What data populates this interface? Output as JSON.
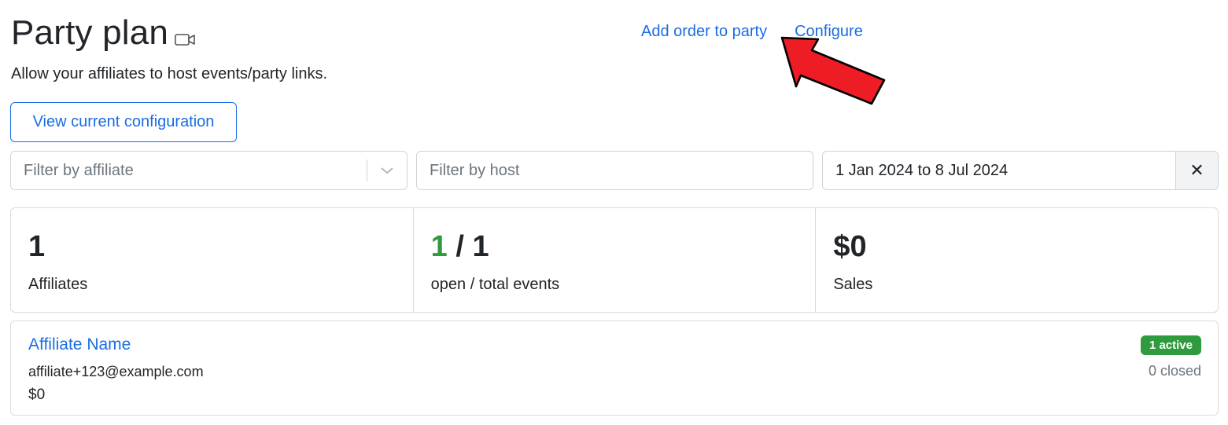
{
  "header": {
    "title": "Party plan",
    "title_icon": "video-camera-icon",
    "subtitle": "Allow your affiliates to host events/party links.",
    "links": {
      "add_order": "Add order to party",
      "configure": "Configure"
    }
  },
  "annotation": {
    "icon": "red-arrow-pointer",
    "color": "#ee1c25"
  },
  "buttons": {
    "view_config": "View current configuration"
  },
  "filters": {
    "affiliate_placeholder": "Filter by affiliate",
    "host_placeholder": "Filter by host",
    "date_range": "1 Jan 2024 to 8 Jul 2024",
    "clear_symbol": "✕"
  },
  "stats": {
    "affiliates": {
      "value": "1",
      "label": "Affiliates"
    },
    "events": {
      "open": "1",
      "separator": " / ",
      "total": "1",
      "label": "open / total events"
    },
    "sales": {
      "value": "$0",
      "label": "Sales"
    }
  },
  "affiliates": [
    {
      "name": "Affiliate Name",
      "email": "affiliate+123@example.com",
      "sales": "$0",
      "active_badge": "1 active",
      "closed": "0 closed"
    }
  ],
  "colors": {
    "link": "#1a6ce3",
    "success": "#2f9a3e",
    "border": "#d8dbde",
    "muted": "#6c757d"
  }
}
